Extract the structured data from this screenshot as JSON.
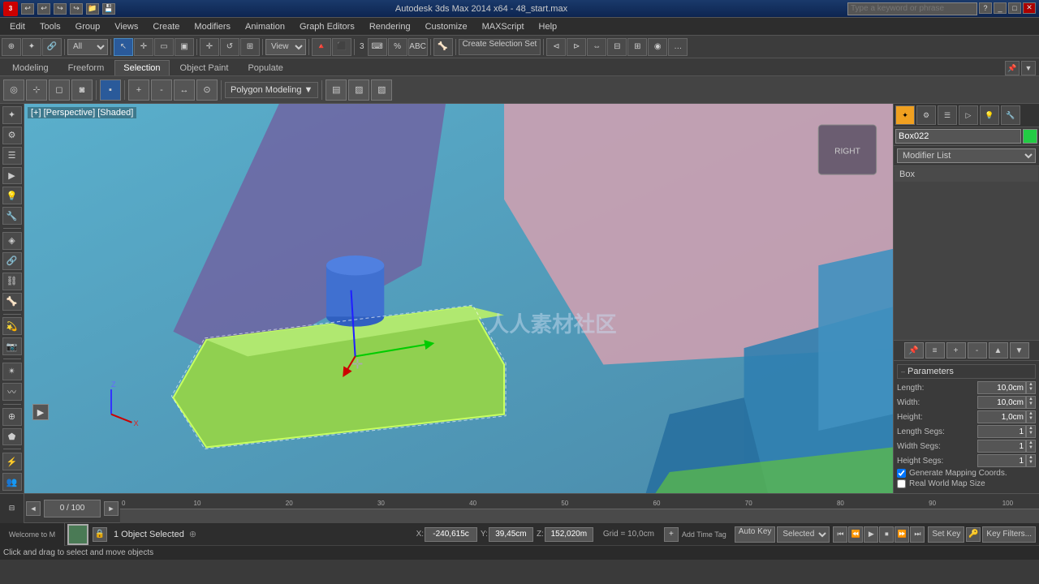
{
  "titlebar": {
    "logo": "3",
    "title": "Autodesk 3ds Max 2014 x64 - 48_start.max",
    "search_placeholder": "Type a keyword or phrase",
    "buttons": [
      "_",
      "□",
      "✕"
    ]
  },
  "menubar": {
    "items": [
      "Edit",
      "Tools",
      "Group",
      "Views",
      "Create",
      "Modifiers",
      "Animation",
      "Graph Editors",
      "Rendering",
      "Customize",
      "MAXScript",
      "Help"
    ]
  },
  "toolbar1": {
    "filter_label": "All",
    "view_label": "View",
    "create_selection_label": "Create Selection Set",
    "number_field": "3"
  },
  "ribbon_tabs": {
    "items": [
      "Modeling",
      "Freeform",
      "Selection",
      "Object Paint",
      "Populate"
    ],
    "active": "Selection"
  },
  "subtoolbar": {
    "poly_model": "Polygon Modeling"
  },
  "viewport": {
    "label": "[+] [Perspective] [Shaded]",
    "watermark": "人人素材社区"
  },
  "right_panel": {
    "object_name": "Box022",
    "object_color": "#22cc44",
    "modifier_list_label": "Modifier List",
    "modifier_stack": [
      "Box"
    ],
    "params_title": "Parameters",
    "params": {
      "length_label": "Length:",
      "length_val": "10,0cm",
      "width_label": "Width:",
      "width_val": "10,0cm",
      "height_label": "Height:",
      "height_val": "1,0cm",
      "length_segs_label": "Length Segs:",
      "length_segs_val": "1",
      "width_segs_label": "Width Segs:",
      "width_segs_val": "1",
      "height_segs_label": "Height Segs:",
      "height_segs_val": "1"
    },
    "generate_mapping": "Generate Mapping Coords.",
    "real_world": "Real World Map Size"
  },
  "timeline": {
    "frame_counter": "0 / 100",
    "ruler_marks": [
      "0",
      "10",
      "20",
      "30",
      "40",
      "50",
      "60",
      "70",
      "80",
      "90",
      "100"
    ]
  },
  "statusbar": {
    "welcome_label": "Welcome to M",
    "select_info": "1 Object Selected",
    "coords": {
      "x_label": "X:",
      "x_val": "-240,615c",
      "y_label": "Y:",
      "y_val": "39,45cm",
      "z_label": "Z:",
      "z_val": "152,020m"
    },
    "grid_label": "Grid = 10,0cm",
    "auto_key_label": "Auto Key",
    "selected_label": "Selected",
    "set_key_label": "Set Key",
    "key_filters_label": "Key Filters..."
  },
  "status_msg": {
    "message": "Click and drag to select and move objects"
  }
}
